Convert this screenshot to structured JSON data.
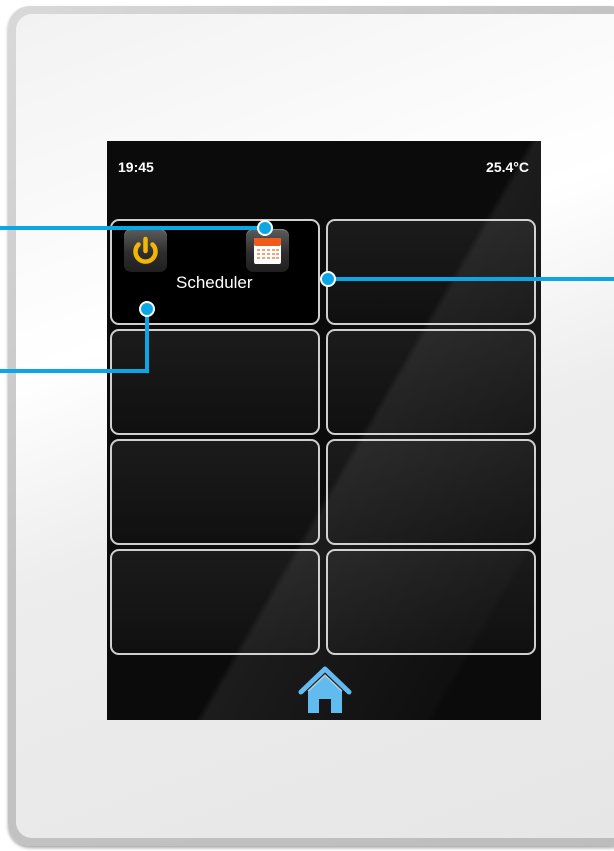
{
  "status": {
    "time": "19:45",
    "temperature": "25.4°C"
  },
  "tiles": {
    "scheduler_label": "Scheduler"
  },
  "icons": {
    "power": "power-icon",
    "calendar": "calendar-icon",
    "home": "home-icon"
  },
  "colors": {
    "callout": "#0aa6e6",
    "power": "#f2b705",
    "home": "#5ab8ee",
    "calendar_header": "#f05a1a"
  }
}
